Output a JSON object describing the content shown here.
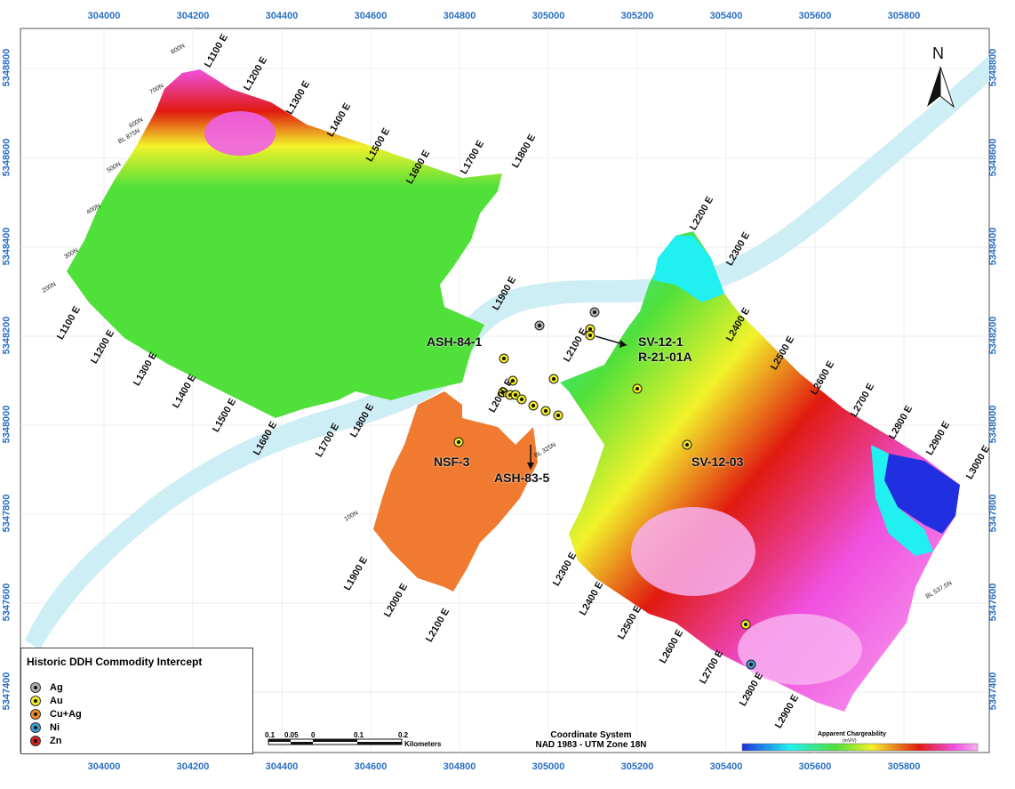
{
  "axes": {
    "x_ticks": [
      "304000",
      "304200",
      "304400",
      "304600",
      "304800",
      "305000",
      "305200",
      "305400",
      "305600",
      "305800"
    ],
    "y_ticks": [
      "5348800",
      "5348600",
      "5348400",
      "5348200",
      "5348000",
      "5347800",
      "5347600",
      "5347400"
    ]
  },
  "north_arrow": {
    "label": "N"
  },
  "survey_lines": [
    "L1100 E",
    "L1200 E",
    "L1300 E",
    "L1400 E",
    "L1500 E",
    "L1600 E",
    "L1700 E",
    "L1800 E",
    "L1900 E",
    "L2000 E",
    "L2100 E",
    "L2200 E",
    "L2300 E",
    "L2400 E",
    "L2500 E",
    "L2600 E",
    "L2700 E",
    "L2800 E",
    "L2900 E",
    "L3000 E"
  ],
  "small_labels": [
    "800N",
    "700N",
    "600N",
    "BL 875N",
    "500N",
    "400N",
    "300N",
    "200N",
    "100N",
    "BL 325N",
    "BL 537.5N"
  ],
  "drillholes": [
    {
      "name": "ASH-84-1"
    },
    {
      "name": "SV-12-1"
    },
    {
      "name": "R-21-01A"
    },
    {
      "name": "NSF-3"
    },
    {
      "name": "ASH-83-5"
    },
    {
      "name": "SV-12-03"
    }
  ],
  "legend": {
    "title": "Historic DDH Commodity Intercept",
    "items": [
      {
        "label": "Ag",
        "color": "#b0b0b0"
      },
      {
        "label": "Au",
        "color": "#f2ea2a"
      },
      {
        "label": "Cu+Ag",
        "color": "#f08a2a"
      },
      {
        "label": "Ni",
        "color": "#3aa0d8"
      },
      {
        "label": "Zn",
        "color": "#d81e1e"
      }
    ]
  },
  "scale_bar": {
    "labels": [
      "0.1",
      "0.05",
      "0",
      "0.1",
      "0.2"
    ],
    "unit": "Kilometers"
  },
  "coordinate_system": {
    "title": "Coordinate System",
    "value": "NAD 1983 - UTM Zone 18N"
  },
  "colorbar": {
    "title": "Apparent Chargeability",
    "unit": "(mV/V)"
  },
  "colors": {
    "river": "#cdeef4",
    "low": "#2030e0",
    "cyan": "#20f0f0",
    "green": "#50e03a",
    "yellow": "#f2f22a",
    "orange": "#f08a2a",
    "red": "#e01a10",
    "magenta": "#f050e0",
    "pink": "#f8b0f0"
  }
}
